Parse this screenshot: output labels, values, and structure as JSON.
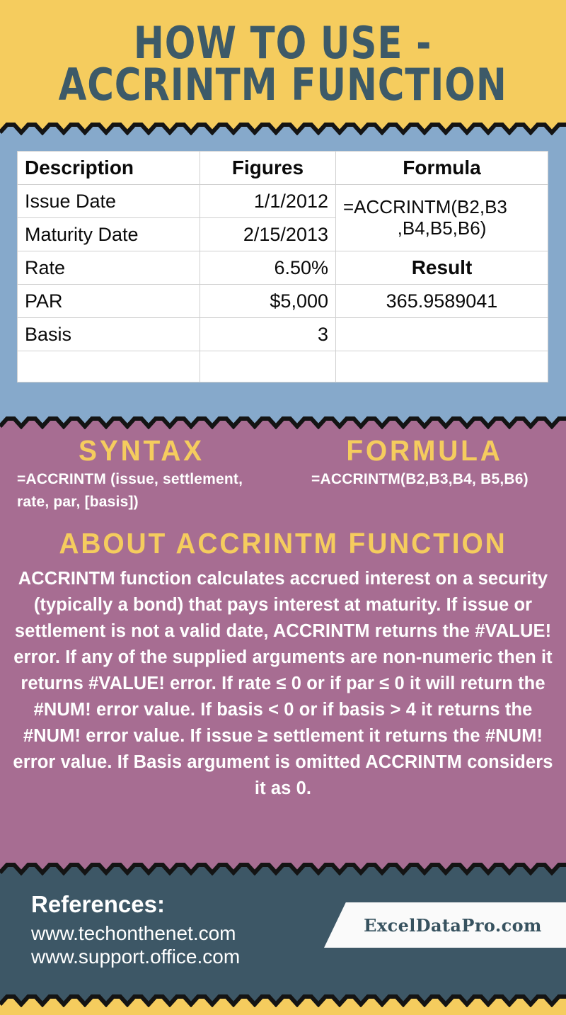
{
  "colors": {
    "yellow": "#f5cc5e",
    "blue": "#86a9cb",
    "mauve": "#a76d92",
    "slate": "#3d5766",
    "title_text": "#3d5a68",
    "white": "#ffffff"
  },
  "header": {
    "title_line1": "HOW TO USE -",
    "title_line2": "ACCRINTM FUNCTION"
  },
  "table": {
    "columns": [
      "Description",
      "Figures",
      "Formula"
    ],
    "rows": [
      {
        "description": "Issue Date",
        "figures": "1/1/2012"
      },
      {
        "description": "Maturity Date",
        "figures": "2/15/2013"
      },
      {
        "description": "Rate",
        "figures": "6.50%"
      },
      {
        "description": "PAR",
        "figures": "$5,000"
      },
      {
        "description": "Basis",
        "figures": "3"
      },
      {
        "description": "",
        "figures": ""
      }
    ],
    "formula_line1": "=ACCRINTM(B2,B3",
    "formula_line2": ",B4,B5,B6)",
    "result_label": "Result",
    "result_value": "365.9589041"
  },
  "syntax": {
    "heading": "SYNTAX",
    "text": "=ACCRINTM (issue, settlement, rate, par, [basis])"
  },
  "formula": {
    "heading": "FORMULA",
    "text": "=ACCRINTM(B2,B3,B4, B5,B6)"
  },
  "about": {
    "heading": "ABOUT ACCRINTM  FUNCTION",
    "text": "ACCRINTM function calculates accrued interest on a security (typically a bond) that pays interest at maturity. If issue or settlement is not a valid date, ACCRINTM returns the #VALUE! error. If any of the supplied arguments are non-numeric then it returns #VALUE! error. If rate ≤ 0 or if par ≤ 0 it will return the #NUM! error value. If basis < 0 or if basis > 4 it returns the #NUM! error value. If issue ≥ settlement it  returns the #NUM! error value. If Basis argument is omitted ACCRINTM considers it as 0."
  },
  "footer": {
    "references_title": "References:",
    "reference_1": "www.techonthenet.com",
    "reference_2": "www.support.office.com",
    "brand": "ExcelDataPro.com"
  }
}
